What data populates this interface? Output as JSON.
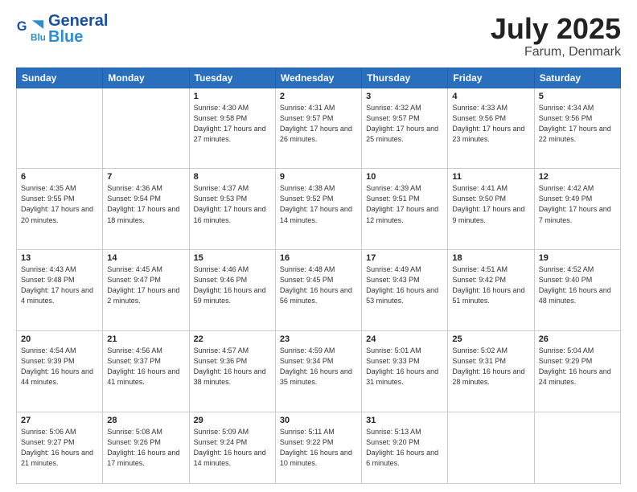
{
  "header": {
    "logo_general": "General",
    "logo_blue": "Blue",
    "month_title": "July 2025",
    "location": "Farum, Denmark"
  },
  "days_of_week": [
    "Sunday",
    "Monday",
    "Tuesday",
    "Wednesday",
    "Thursday",
    "Friday",
    "Saturday"
  ],
  "weeks": [
    [
      {
        "day": "",
        "info": ""
      },
      {
        "day": "",
        "info": ""
      },
      {
        "day": "1",
        "info": "Sunrise: 4:30 AM\nSunset: 9:58 PM\nDaylight: 17 hours and 27 minutes."
      },
      {
        "day": "2",
        "info": "Sunrise: 4:31 AM\nSunset: 9:57 PM\nDaylight: 17 hours and 26 minutes."
      },
      {
        "day": "3",
        "info": "Sunrise: 4:32 AM\nSunset: 9:57 PM\nDaylight: 17 hours and 25 minutes."
      },
      {
        "day": "4",
        "info": "Sunrise: 4:33 AM\nSunset: 9:56 PM\nDaylight: 17 hours and 23 minutes."
      },
      {
        "day": "5",
        "info": "Sunrise: 4:34 AM\nSunset: 9:56 PM\nDaylight: 17 hours and 22 minutes."
      }
    ],
    [
      {
        "day": "6",
        "info": "Sunrise: 4:35 AM\nSunset: 9:55 PM\nDaylight: 17 hours and 20 minutes."
      },
      {
        "day": "7",
        "info": "Sunrise: 4:36 AM\nSunset: 9:54 PM\nDaylight: 17 hours and 18 minutes."
      },
      {
        "day": "8",
        "info": "Sunrise: 4:37 AM\nSunset: 9:53 PM\nDaylight: 17 hours and 16 minutes."
      },
      {
        "day": "9",
        "info": "Sunrise: 4:38 AM\nSunset: 9:52 PM\nDaylight: 17 hours and 14 minutes."
      },
      {
        "day": "10",
        "info": "Sunrise: 4:39 AM\nSunset: 9:51 PM\nDaylight: 17 hours and 12 minutes."
      },
      {
        "day": "11",
        "info": "Sunrise: 4:41 AM\nSunset: 9:50 PM\nDaylight: 17 hours and 9 minutes."
      },
      {
        "day": "12",
        "info": "Sunrise: 4:42 AM\nSunset: 9:49 PM\nDaylight: 17 hours and 7 minutes."
      }
    ],
    [
      {
        "day": "13",
        "info": "Sunrise: 4:43 AM\nSunset: 9:48 PM\nDaylight: 17 hours and 4 minutes."
      },
      {
        "day": "14",
        "info": "Sunrise: 4:45 AM\nSunset: 9:47 PM\nDaylight: 17 hours and 2 minutes."
      },
      {
        "day": "15",
        "info": "Sunrise: 4:46 AM\nSunset: 9:46 PM\nDaylight: 16 hours and 59 minutes."
      },
      {
        "day": "16",
        "info": "Sunrise: 4:48 AM\nSunset: 9:45 PM\nDaylight: 16 hours and 56 minutes."
      },
      {
        "day": "17",
        "info": "Sunrise: 4:49 AM\nSunset: 9:43 PM\nDaylight: 16 hours and 53 minutes."
      },
      {
        "day": "18",
        "info": "Sunrise: 4:51 AM\nSunset: 9:42 PM\nDaylight: 16 hours and 51 minutes."
      },
      {
        "day": "19",
        "info": "Sunrise: 4:52 AM\nSunset: 9:40 PM\nDaylight: 16 hours and 48 minutes."
      }
    ],
    [
      {
        "day": "20",
        "info": "Sunrise: 4:54 AM\nSunset: 9:39 PM\nDaylight: 16 hours and 44 minutes."
      },
      {
        "day": "21",
        "info": "Sunrise: 4:56 AM\nSunset: 9:37 PM\nDaylight: 16 hours and 41 minutes."
      },
      {
        "day": "22",
        "info": "Sunrise: 4:57 AM\nSunset: 9:36 PM\nDaylight: 16 hours and 38 minutes."
      },
      {
        "day": "23",
        "info": "Sunrise: 4:59 AM\nSunset: 9:34 PM\nDaylight: 16 hours and 35 minutes."
      },
      {
        "day": "24",
        "info": "Sunrise: 5:01 AM\nSunset: 9:33 PM\nDaylight: 16 hours and 31 minutes."
      },
      {
        "day": "25",
        "info": "Sunrise: 5:02 AM\nSunset: 9:31 PM\nDaylight: 16 hours and 28 minutes."
      },
      {
        "day": "26",
        "info": "Sunrise: 5:04 AM\nSunset: 9:29 PM\nDaylight: 16 hours and 24 minutes."
      }
    ],
    [
      {
        "day": "27",
        "info": "Sunrise: 5:06 AM\nSunset: 9:27 PM\nDaylight: 16 hours and 21 minutes."
      },
      {
        "day": "28",
        "info": "Sunrise: 5:08 AM\nSunset: 9:26 PM\nDaylight: 16 hours and 17 minutes."
      },
      {
        "day": "29",
        "info": "Sunrise: 5:09 AM\nSunset: 9:24 PM\nDaylight: 16 hours and 14 minutes."
      },
      {
        "day": "30",
        "info": "Sunrise: 5:11 AM\nSunset: 9:22 PM\nDaylight: 16 hours and 10 minutes."
      },
      {
        "day": "31",
        "info": "Sunrise: 5:13 AM\nSunset: 9:20 PM\nDaylight: 16 hours and 6 minutes."
      },
      {
        "day": "",
        "info": ""
      },
      {
        "day": "",
        "info": ""
      }
    ]
  ]
}
